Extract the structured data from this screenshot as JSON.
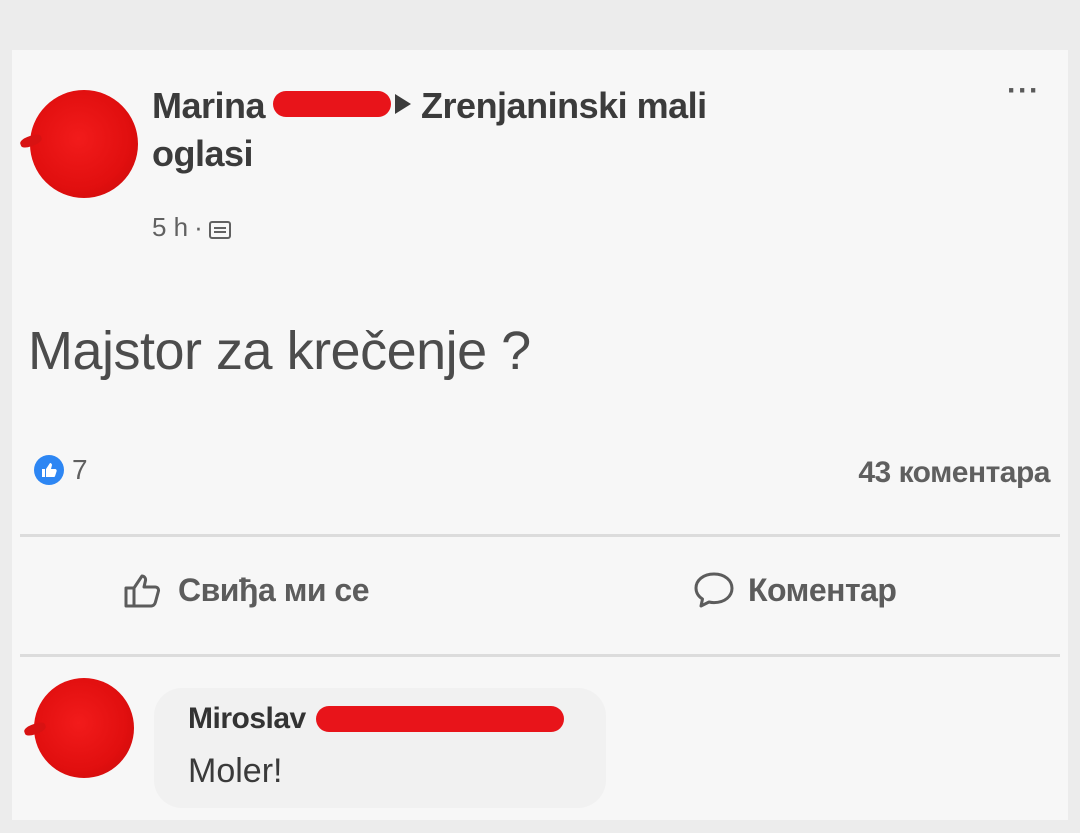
{
  "post": {
    "author_first_name": "Marina",
    "group_name": "Zrenjaninski mali",
    "group_name_line2": "oglasi",
    "time_ago": "5 h",
    "separator": "·",
    "audience_icon": "group-icon",
    "more_label": "···",
    "text": "Majstor za krečenje ?"
  },
  "stats": {
    "reaction_icon": "like-icon",
    "reaction_color": "#2d86f3",
    "reaction_count": "7",
    "comment_count": "43 коментара"
  },
  "actions": {
    "like_label": "Свиђа ми се",
    "comment_label": "Коментар"
  },
  "comment": {
    "author_first_name": "Miroslav",
    "text": "Moler!"
  },
  "colors": {
    "redaction": "#e8141a",
    "avatar": "#e10f0f"
  }
}
